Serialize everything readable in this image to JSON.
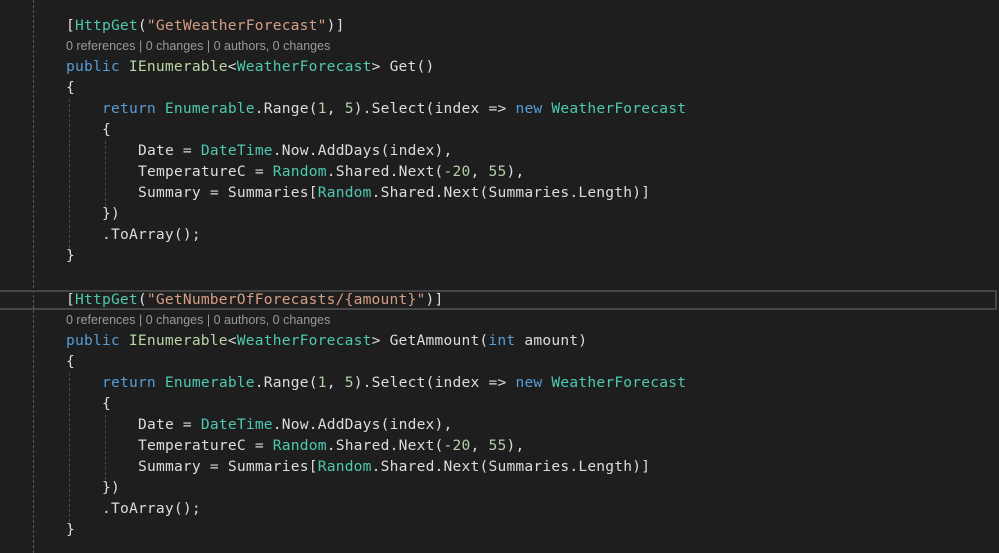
{
  "editor": {
    "method1": {
      "attribute": {
        "open": "[",
        "name": "HttpGet",
        "lparen": "(",
        "route": "\"GetWeatherForecast\"",
        "close": ")]"
      },
      "codelens": {
        "references": "0 references",
        "changes": "0 changes",
        "authors": "0 authors, 0 changes"
      },
      "signature": {
        "modifier": "public",
        "return_type": "IEnumerable",
        "lt": "<",
        "generic": "WeatherForecast",
        "gt": ">",
        "name": " Get()"
      },
      "open_brace": "{",
      "return_line": {
        "kw": "return",
        "type": "Enumerable",
        "call": ".Range(",
        "n1": "1",
        ", ": ", ",
        "n2": "5",
        "rest": ").Select(index => ",
        "new_kw": "new",
        "new_type": "WeatherForecast"
      },
      "init_open": "{",
      "date_line": {
        "lhs": "Date = ",
        "type": "DateTime",
        "rest": ".Now.AddDays(index),"
      },
      "temp_line": {
        "lhs": "TemperatureC = ",
        "type": "Random",
        "mid": ".Shared.Next(",
        "n1": "-20",
        "sep": ", ",
        "n2": "55",
        "end": "),"
      },
      "summary_line": {
        "lhs": "Summary = Summaries[",
        "type": "Random",
        "rest": ".Shared.Next(Summaries.Length)]"
      },
      "init_close": "})",
      "to_array": ".ToArray();",
      "close_brace": "}"
    },
    "method2": {
      "attribute": {
        "open": "[",
        "name": "HttpGet",
        "lparen": "(",
        "route": "\"GetNumberOfForecasts/{amount}\"",
        "close": ")]"
      },
      "codelens": {
        "references": "0 references",
        "changes": "0 changes",
        "authors": "0 authors, 0 changes"
      },
      "signature": {
        "modifier": "public",
        "return_type": "IEnumerable",
        "lt": "<",
        "generic": "WeatherForecast",
        "gt": ">",
        "name": " GetAmmount(",
        "param_type": "int",
        "param_name": " amount)"
      },
      "open_brace": "{",
      "return_line": {
        "kw": "return",
        "type": "Enumerable",
        "call": ".Range(",
        "n1": "1",
        ", ": ", ",
        "n2": "5",
        "rest": ").Select(index => ",
        "new_kw": "new",
        "new_type": "WeatherForecast"
      },
      "init_open": "{",
      "date_line": {
        "lhs": "Date = ",
        "type": "DateTime",
        "rest": ".Now.AddDays(index),"
      },
      "temp_line": {
        "lhs": "TemperatureC = ",
        "type": "Random",
        "mid": ".Shared.Next(",
        "n1": "-20",
        "sep": ", ",
        "n2": "55",
        "end": "),"
      },
      "summary_line": {
        "lhs": "Summary = Summaries[",
        "type": "Random",
        "rest": ".Shared.Next(Summaries.Length)]"
      },
      "init_close": "})",
      "to_array": ".ToArray();",
      "close_brace": "}"
    },
    "codelens_separator": " | "
  }
}
